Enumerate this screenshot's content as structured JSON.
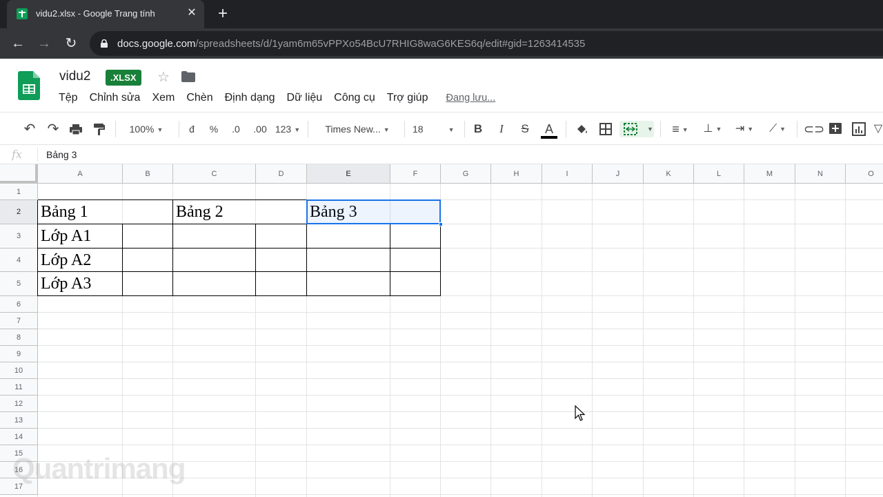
{
  "browser": {
    "tab_title": "vidu2.xlsx - Google Trang tính",
    "url_host": "docs.google.com",
    "url_path": "/spreadsheets/d/1yam6m65vPPXo54BcU7RHIG8waG6KES6q/edit#gid=1263414535"
  },
  "doc": {
    "title": "vidu2",
    "badge": ".XLSX",
    "menu": [
      "Tệp",
      "Chỉnh sửa",
      "Xem",
      "Chèn",
      "Định dạng",
      "Dữ liệu",
      "Công cụ",
      "Trợ giúp"
    ],
    "saving": "Đang lưu..."
  },
  "toolbar": {
    "zoom": "100%",
    "currency": "đ",
    "percent": "%",
    "dec_less": ".0",
    "dec_more": ".00",
    "number_format": "123",
    "font": "Times New...",
    "font_size": "18"
  },
  "formula": {
    "fx": "fx",
    "value": "Bảng 3"
  },
  "grid": {
    "columns": [
      "A",
      "B",
      "C",
      "D",
      "E",
      "F",
      "G",
      "H",
      "I",
      "J",
      "K",
      "L",
      "M",
      "N",
      "O"
    ],
    "rows": [
      "1",
      "2",
      "3",
      "4",
      "5",
      "6",
      "7",
      "8",
      "9",
      "10",
      "11",
      "12",
      "13",
      "14",
      "15",
      "16",
      "17"
    ],
    "cells": {
      "A2": "Bảng 1",
      "C2": "Bảng 2",
      "E2": "Bảng 3",
      "A3": "Lớp A1",
      "A4": "Lớp A2",
      "A5": "Lớp A3"
    },
    "selected_cell": "E2"
  },
  "colors": {
    "selection": "#1a73e8",
    "sheets_green": "#0f9d58"
  }
}
